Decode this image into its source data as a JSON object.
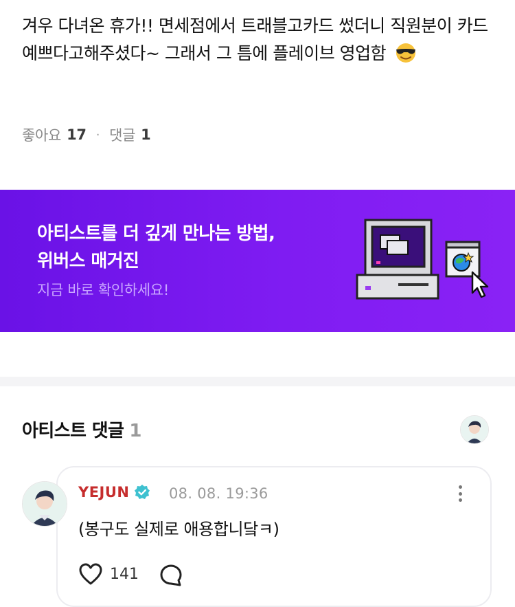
{
  "post": {
    "text": "겨우 다녀온 휴가!! 면세점에서 트래블고카드 썼더니 직원분이 카드 예쁘다고해주셨다~ 그래서 그 틈에 플레이브 영업함",
    "emoji": "smiling-face-with-sunglasses-icon"
  },
  "stats": {
    "likes_label": "좋아요",
    "likes_count": "17",
    "separator": "·",
    "comments_label": "댓글",
    "comments_count": "1"
  },
  "banner": {
    "title_line1": "아티스트를 더 깊게 만나는 방법,",
    "title_line2": "위버스 매거진",
    "subtitle": "지금 바로 확인하세요!",
    "art": "retro-computer-icon",
    "colors": {
      "gradient_start": "#6a12e6",
      "gradient_end": "#8a22f5",
      "subtitle": "#c9a6ff"
    }
  },
  "artist_comments": {
    "title": "아티스트 댓글",
    "count": "1"
  },
  "comment": {
    "author": "YEJUN",
    "author_color": "#c62d2d",
    "verified_color": "#3ec1d0",
    "time": "08. 08. 19:36",
    "text": "(봉구도 실제로 애용합니닼ㅋ)",
    "likes": "141"
  }
}
